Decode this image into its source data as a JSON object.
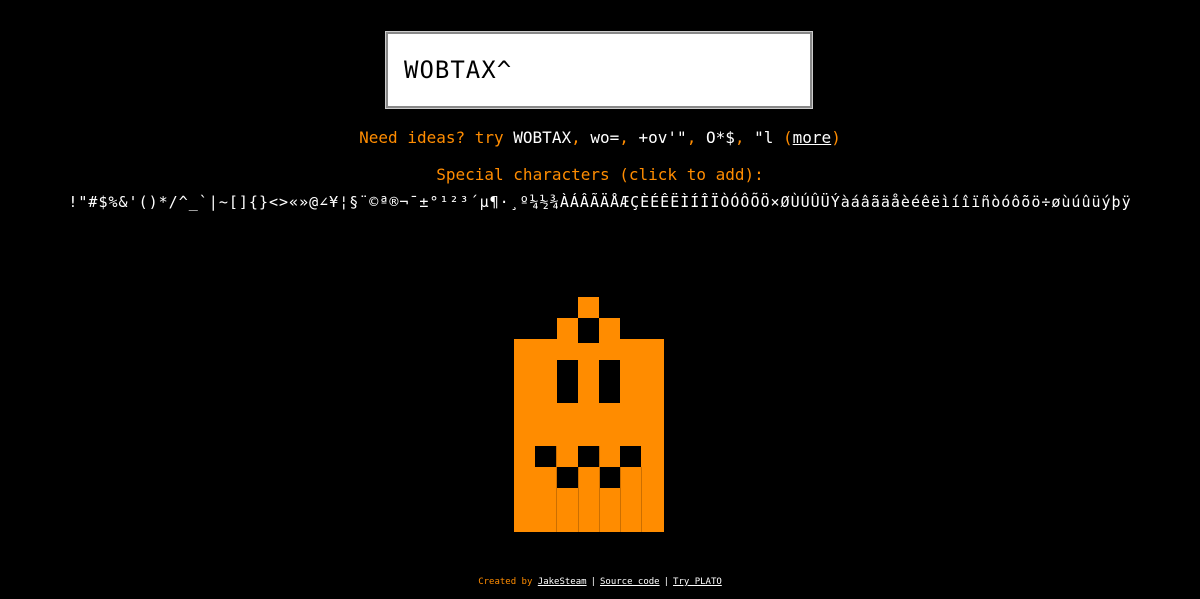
{
  "input": {
    "value": "WOBTAX^"
  },
  "ideas": {
    "prefix": "Need ideas? try ",
    "examples": [
      "WOBTAX",
      "wo=",
      "+ov'\"",
      "O*$",
      "\"l"
    ],
    "separator": ", ",
    "more_open": " (",
    "more_label": "more",
    "more_close": ")"
  },
  "special": {
    "title": "Special characters (click to add):",
    "characters": "!\"#$%&'()*/^_`|~[]{}<>«»@∠¥¦§¨©ª®¬¯±°¹²³´µ¶·¸º¼½¾ÀÁÂÃÄÅÆÇÈÉÊËÌÍÎÏÒÓÔÕÖ×ØÙÚÛÜÝàáâãäåèéêëìíîïñòóôõö÷øùúûüýþÿ"
  },
  "colors": {
    "background": "#000000",
    "accent": "#ff8c00",
    "text": "#ffffff"
  },
  "footer": {
    "created_by": "Created by",
    "author": "JakeSteam",
    "source": "Source code",
    "try_label": "Try PLATO",
    "bar": "|"
  }
}
